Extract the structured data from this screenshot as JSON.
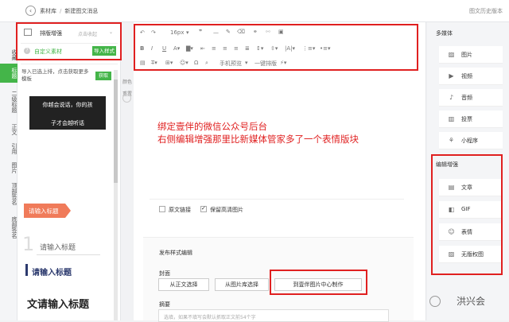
{
  "breadcrumb": {
    "root": "素材库",
    "separator": "/",
    "current": "新建图文消息"
  },
  "history_label": "图文历史版本",
  "vertical_tabs": [
    "收藏",
    "标题",
    "二级标题",
    "正文",
    "引用",
    "图片",
    "顶部签名",
    "底部签名"
  ],
  "left_panel": {
    "plugin_name": "排版增强",
    "plugin_action": "点击收起",
    "custom_material": "自定义素材",
    "import_style": "导入样式",
    "import_tip": "导入已选上排，点击获取更多模板",
    "get_button": "获取",
    "sample_text_line1": "你越会说话，你的孩",
    "sample_text_line2": "子才会越听话",
    "title_tag": "请输入标题",
    "title_num": "1",
    "title_num_label": "请输入标题",
    "title_bar": "请输入标题",
    "title_big": "文请输入标题"
  },
  "editor_side": {
    "color": "颜色",
    "reset": "重置"
  },
  "toolbar": {
    "font_size": "16px",
    "phone_preview": "手机预览",
    "one_click_layout": "一键排版"
  },
  "caption": {
    "line1": "绑定壹伴的微信公众号后台",
    "line2": "右侧编辑增强那里比新媒体管家多了一个表情版块"
  },
  "options": {
    "original_link": "原文链接",
    "keep_hd": "保留高清图片"
  },
  "publish": {
    "section_title": "发布样式编辑",
    "cover_label": "封面",
    "from_body": "从正文选择",
    "from_library": "从图片库选择",
    "to_yiban": "到壹伴图片中心制作",
    "summary_label": "摘要",
    "summary_placeholder": "选填，如果不填写会默认抓取正文前54个字"
  },
  "right_panel": {
    "media_title": "多媒体",
    "media_items": [
      {
        "label": "图片",
        "icon": "image-icon"
      },
      {
        "label": "视频",
        "icon": "video-icon"
      },
      {
        "label": "音频",
        "icon": "microphone-icon"
      },
      {
        "label": "投票",
        "icon": "bar-chart-icon"
      },
      {
        "label": "小程序",
        "icon": "mini-program-icon"
      }
    ],
    "enhance_title": "编辑增强",
    "enhance_items": [
      {
        "label": "文章",
        "icon": "document-icon"
      },
      {
        "label": "GIF",
        "icon": "gif-icon"
      },
      {
        "label": "表情",
        "icon": "emoji-icon"
      },
      {
        "label": "无版权图",
        "icon": "picture-icon"
      }
    ]
  },
  "watermark": "洪兴会",
  "colors": {
    "accent_green": "#44b549",
    "annotation_red": "#e02020",
    "tag_orange": "#f07b5a",
    "bar_navy": "#2c3a6e"
  }
}
